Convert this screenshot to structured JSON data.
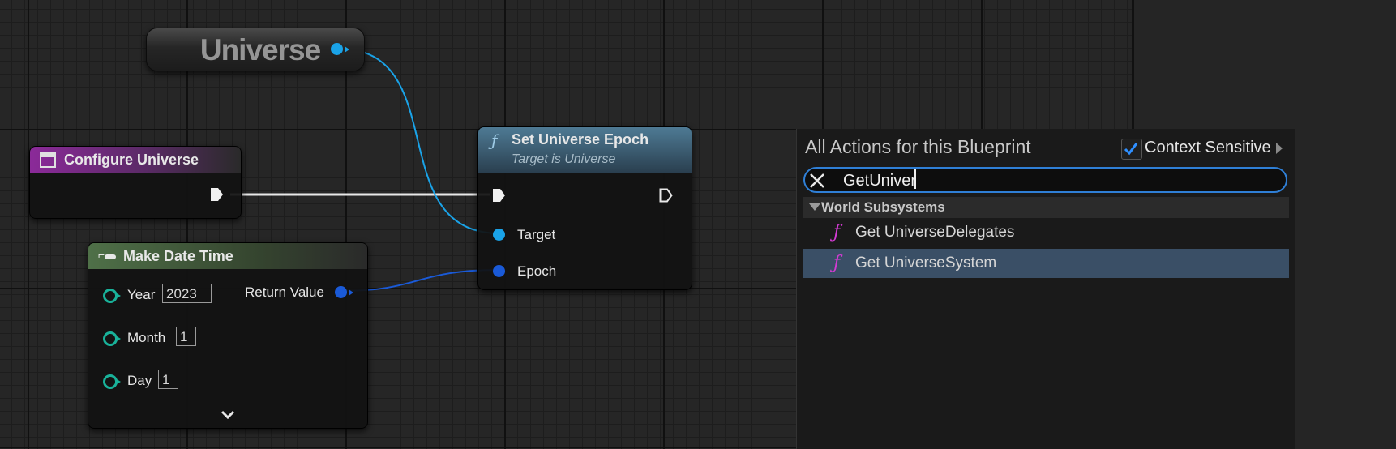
{
  "graph": {
    "variable_node": {
      "title": "Universe"
    },
    "configure_node": {
      "title": "Configure Universe"
    },
    "set_epoch_node": {
      "title": "Set Universe Epoch",
      "subtitle": "Target is Universe",
      "pins": {
        "target": "Target",
        "epoch": "Epoch"
      }
    },
    "make_datetime_node": {
      "title": "Make Date Time",
      "pins": [
        {
          "label": "Year",
          "value": "2023"
        },
        {
          "label": "Month",
          "value": "1"
        },
        {
          "label": "Day",
          "value": "1"
        }
      ],
      "return_label": "Return Value"
    },
    "colors": {
      "object_pin": "#1aa3e8",
      "struct_pin": "#1a5ad8",
      "int_pin": "#19b29a",
      "function_icon": "#d23bd2"
    }
  },
  "action_menu": {
    "title": "All Actions for this Blueprint",
    "context_sensitive_label": "Context Sensitive",
    "context_sensitive_checked": true,
    "search_value": "GetUniver",
    "category": "World Subsystems",
    "items": [
      {
        "label": "Get UniverseDelegates",
        "icon": "function-icon",
        "selected": false
      },
      {
        "label": "Get UniverseSystem",
        "icon": "function-icon",
        "selected": true
      }
    ]
  }
}
